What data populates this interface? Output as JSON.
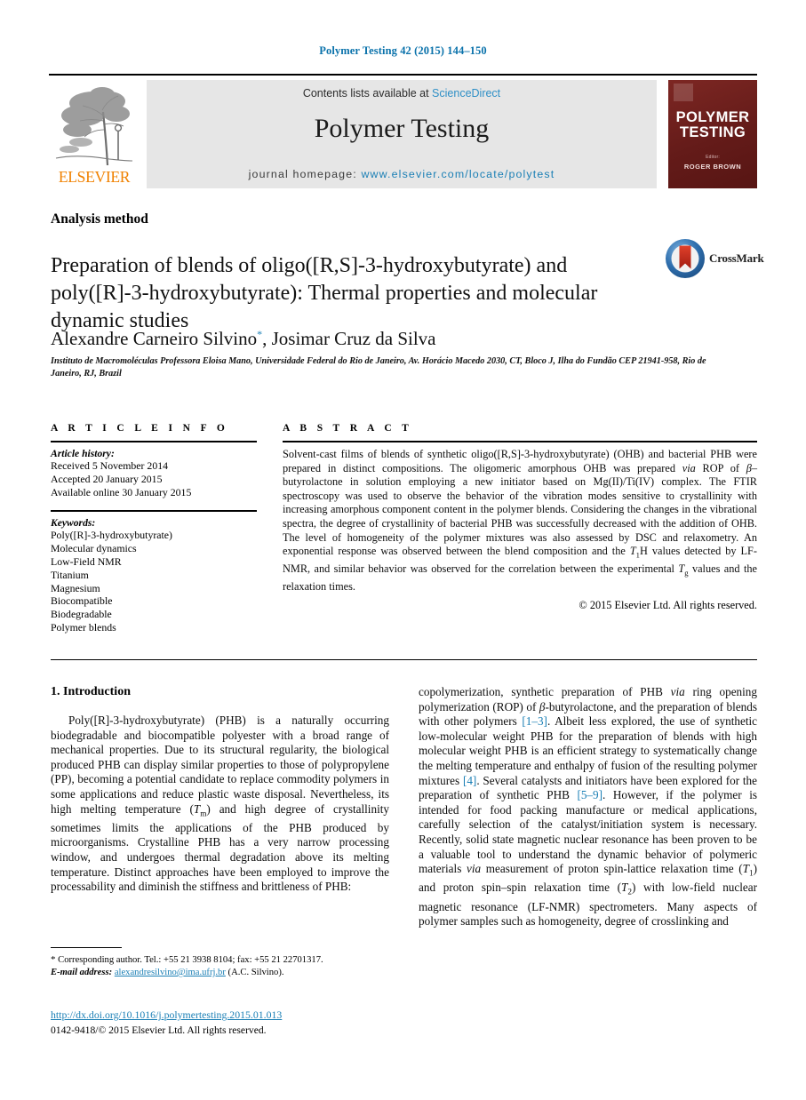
{
  "running_head": "Polymer Testing 42 (2015) 144–150",
  "masthead": {
    "contents_line_prefix": "Contents lists available at ",
    "contents_line_link": "ScienceDirect",
    "journal_name": "Polymer Testing",
    "homepage_prefix": "journal homepage: ",
    "homepage_url": "www.elsevier.com/locate/polytest",
    "publisher_logo_word": "ELSEVIER",
    "publisher_logo_icon": "elsevier-tree-icon",
    "cover": {
      "title_line1": "POLYMER",
      "title_line2": "TESTING",
      "editor_label": "Editor:",
      "editor_name": "ROGER BROWN"
    },
    "accent_link_color": "#1a7fb5",
    "band_color": "#e6e6e6",
    "cover_color": "#6d1f1c",
    "elsevier_orange": "#f08100"
  },
  "article": {
    "kind": "Analysis method",
    "title": "Preparation of blends of oligo([R,S]-3-hydroxybutyrate) and poly([R]-3-hydroxybutyrate): Thermal properties and molecular dynamic studies",
    "crossmark_label": "CrossMark",
    "authors": "Alexandre Carneiro Silvino, Josimar Cruz da Silva",
    "author_1": "Alexandre Carneiro Silvino",
    "author_2": "Josimar Cruz da Silva",
    "corresponding_marker": "*",
    "affiliation": "Instituto de Macromoléculas Professora Eloisa Mano, Universidade Federal do Rio de Janeiro, Av. Horácio Macedo 2030, CT, Bloco J, Ilha do Fundão CEP 21941-958, Rio de Janeiro, RJ, Brazil"
  },
  "article_info": {
    "heading": "A R T I C L E   I N F O",
    "history_label": "Article history:",
    "history": [
      "Received 5 November 2014",
      "Accepted 20 January 2015",
      "Available online 30 January 2015"
    ],
    "keywords_label": "Keywords:",
    "keywords": [
      "Poly([R]-3-hydroxybutyrate)",
      "Molecular dynamics",
      "Low-Field NMR",
      "Titanium",
      "Magnesium",
      "Biocompatible",
      "Biodegradable",
      "Polymer blends"
    ]
  },
  "abstract": {
    "heading": "A B S T R A C T",
    "copyright": "© 2015 Elsevier Ltd. All rights reserved."
  },
  "introduction": {
    "heading": "1. Introduction"
  },
  "footnote": {
    "corresponding": "Corresponding author. Tel.: +55 21 3938 8104; fax: +55 21 22701317.",
    "email_label": "E-mail address:",
    "email": "alexandresilvino@ima.ufrj.br",
    "email_owner": "(A.C. Silvino).",
    "doi": "http://dx.doi.org/10.1016/j.polymertesting.2015.01.013",
    "issn_line": "0142-9418/© 2015 Elsevier Ltd. All rights reserved."
  }
}
